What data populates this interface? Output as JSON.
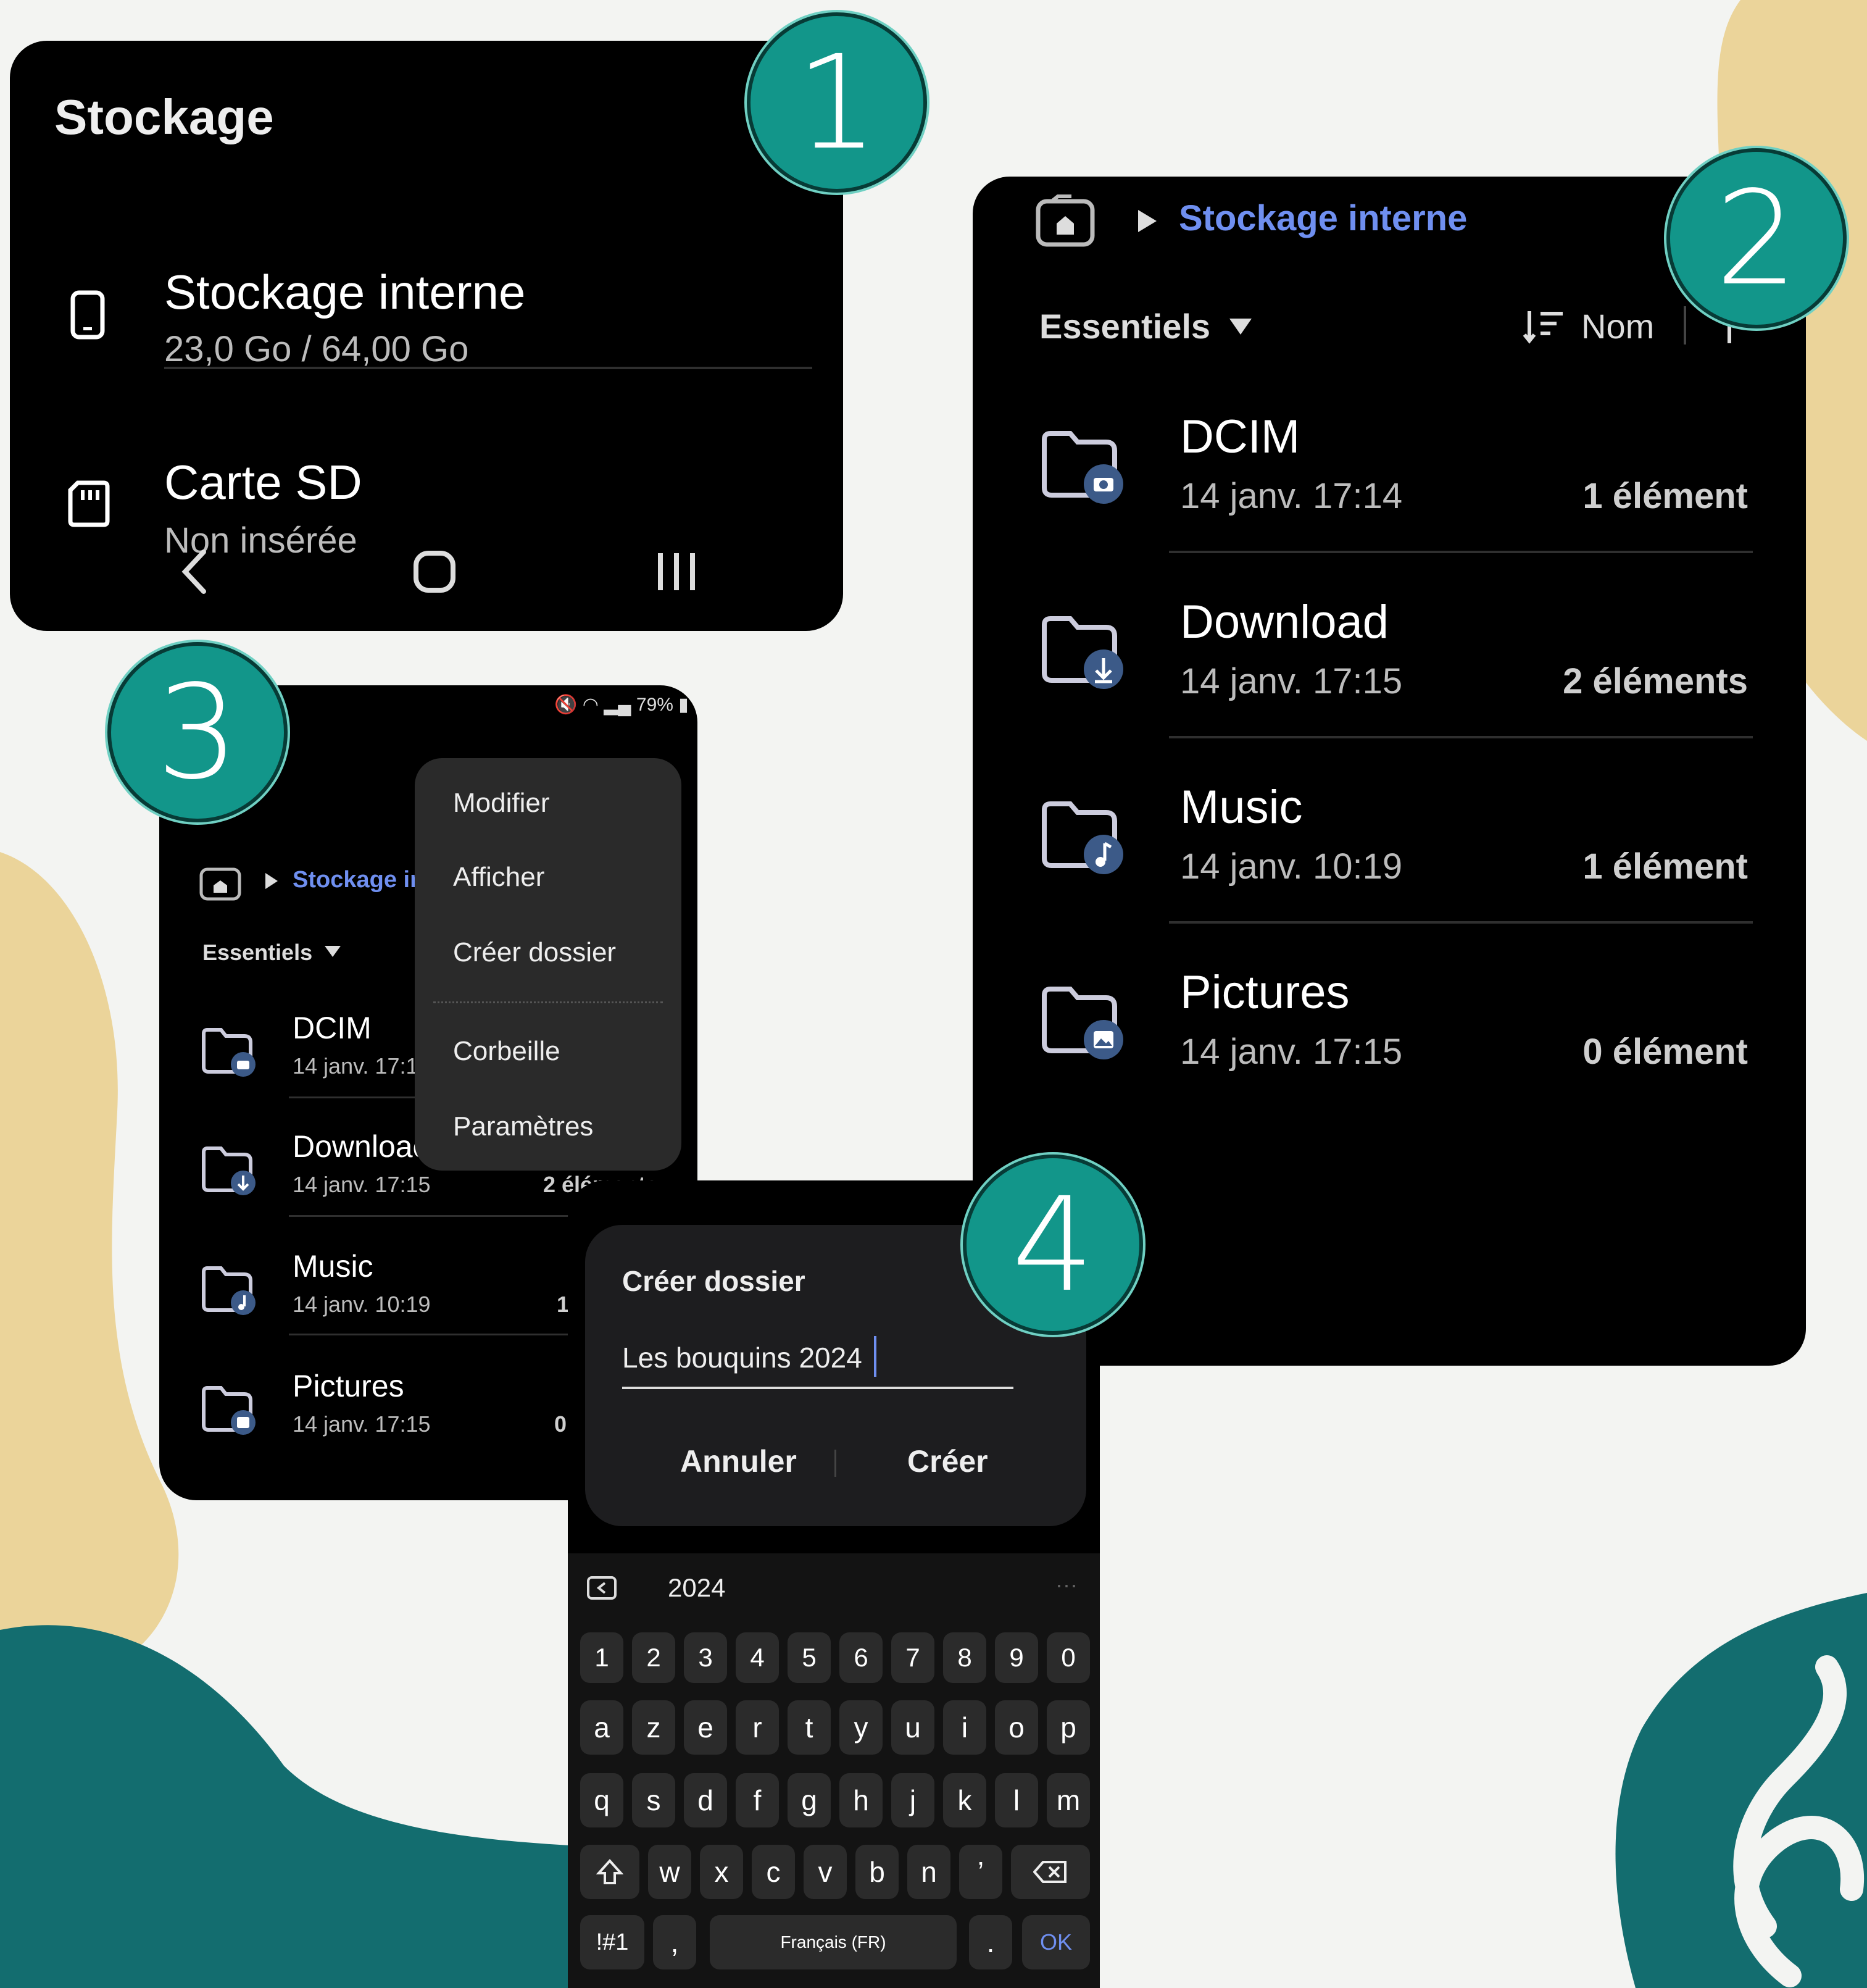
{
  "badges": [
    "1",
    "2",
    "3",
    "4"
  ],
  "panel1": {
    "title": "Stockage",
    "internal": {
      "name": "Stockage interne",
      "usage": "23,0 Go / 64,00 Go"
    },
    "sd": {
      "name": "Carte SD",
      "status": "Non insérée"
    },
    "nav": {
      "back": "back-icon",
      "home": "home-circle-icon",
      "recent": "recents-icon"
    }
  },
  "panel2": {
    "breadcrumb": "Stockage interne",
    "filter": "Essentiels",
    "sort": "Nom",
    "folders": [
      {
        "name": "DCIM",
        "date": "14 janv. 17:14",
        "count": "1 élément",
        "icon": "camera"
      },
      {
        "name": "Download",
        "date": "14 janv. 17:15",
        "count": "2 éléments",
        "icon": "download"
      },
      {
        "name": "Music",
        "date": "14 janv. 10:19",
        "count": "1 élément",
        "icon": "music"
      },
      {
        "name": "Pictures",
        "date": "14 janv. 17:15",
        "count": "0 élément",
        "icon": "image"
      }
    ]
  },
  "panel3": {
    "status": "79%",
    "breadcrumb": "Stockage in",
    "filter": "Essentiels",
    "folders": [
      {
        "name": "DCIM",
        "date": "14 janv. 17:1",
        "count": ""
      },
      {
        "name": "Downloac",
        "date": "14 janv. 17:15",
        "count": "2 éléments"
      },
      {
        "name": "Music",
        "date": "14 janv. 10:19",
        "count": "1"
      },
      {
        "name": "Pictures",
        "date": "14 janv. 17:15",
        "count": "0"
      }
    ],
    "menu": [
      "Modifier",
      "Afficher",
      "Créer dossier",
      "Corbeille",
      "Paramètres"
    ]
  },
  "panel4": {
    "dialog_title": "Créer dossier",
    "input_value": "Les bouquins 2024",
    "cancel": "Annuler",
    "create": "Créer",
    "suggestion": "2024",
    "keyboard": {
      "row_numbers": [
        "1",
        "2",
        "3",
        "4",
        "5",
        "6",
        "7",
        "8",
        "9",
        "0"
      ],
      "row1": [
        "a",
        "z",
        "e",
        "r",
        "t",
        "y",
        "u",
        "i",
        "o",
        "p"
      ],
      "row2": [
        "q",
        "s",
        "d",
        "f",
        "g",
        "h",
        "j",
        "k",
        "l",
        "m"
      ],
      "row3": [
        "w",
        "x",
        "c",
        "v",
        "b",
        "n",
        "’"
      ],
      "symbols": "!#1",
      "comma": ",",
      "space": "Français (FR)",
      "period": ".",
      "ok": "OK"
    }
  },
  "colors": {
    "teal": "#12968a",
    "sand": "#ebd49a",
    "dark_teal": "#136d6f",
    "accent_blue": "#6f8ff0"
  }
}
